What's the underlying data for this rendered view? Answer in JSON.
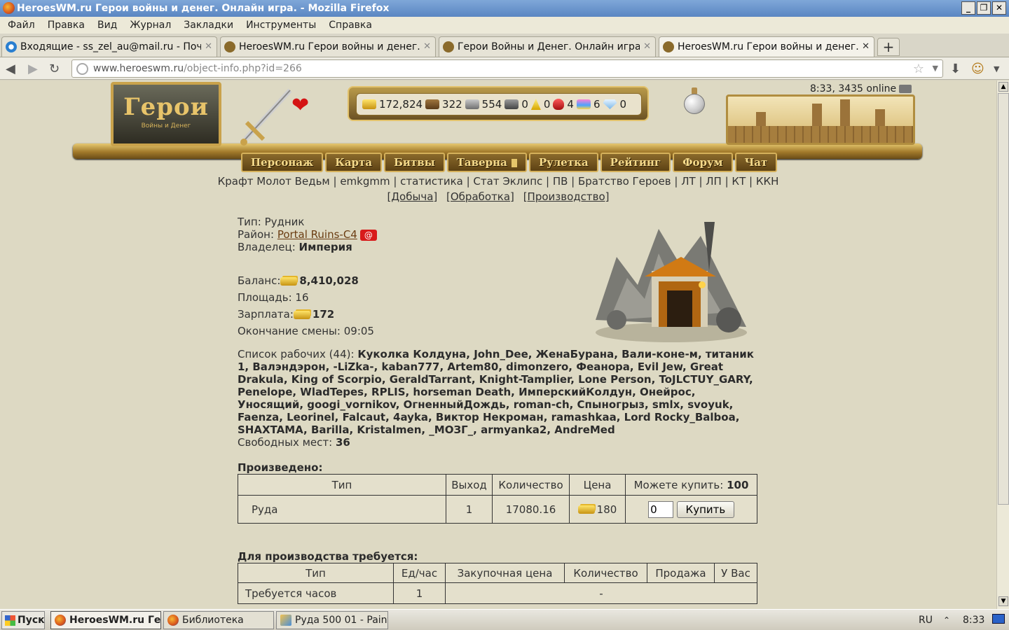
{
  "window": {
    "title": "HeroesWM.ru Герои войны и денег. Онлайн игра. - Mozilla Firefox",
    "buttons": [
      "_",
      "❐",
      "✕"
    ]
  },
  "menu": [
    "Файл",
    "Правка",
    "Вид",
    "Журнал",
    "Закладки",
    "Инструменты",
    "Справка"
  ],
  "tabs": [
    {
      "title": "Входящие - ss_zel_au@mail.ru - Почта ..."
    },
    {
      "title": "HeroesWM.ru Герои войны и денег. Он..."
    },
    {
      "title": "Герои Войны и Денег. Онлайн игра."
    },
    {
      "title": "HeroesWM.ru Герои войны и денег. Он..."
    }
  ],
  "url": {
    "host": "www.heroeswm.ru",
    "path": "/object-info.php?id=266"
  },
  "header": {
    "logo_big": "Герои",
    "logo_small": "Войны и Денег",
    "resources": {
      "gold": "172,824",
      "wood": "322",
      "ore": "554",
      "mercury": "0",
      "sulfur": "0",
      "crystal": "4",
      "gems": "6",
      "diamonds": "0"
    },
    "clock": "8:33, 3435 online"
  },
  "nav": [
    "Персонаж",
    "Карта",
    "Битвы",
    "Таверна",
    "Рулетка",
    "Рейтинг",
    "Форум",
    "Чат"
  ],
  "sublinks": "Крафт Молот Ведьм | emkgmm | статистика | Стат Эклипс | ПВ | Братство Героев | ЛТ | ЛП | КТ | ККН",
  "subsections": [
    "[Добыча]",
    "[Обработка]",
    "[Производство]"
  ],
  "object": {
    "type_label": "Тип:",
    "type_value": "Рудник",
    "district_label": "Район:",
    "district_value": "Portal Ruins-C4",
    "district_badge": "@",
    "owner_label": "Владелец:",
    "owner_value": "Империя",
    "balance_label": "Баланс:",
    "balance_value": "8,410,028",
    "area_label": "Площадь:",
    "area_value": "16",
    "salary_label": "Зарплата:",
    "salary_value": "172",
    "shift_label": "Окончание смены:",
    "shift_value": "09:05",
    "workers_label": "Список рабочих (44):",
    "workers": "Куколка Колдуна, John_Dee, ЖенаБурана, Вали-коне-м, титаник 1, Валэндэрон, -LiZka-, kaban777, Artem80, dimonzero, Феанора, Evil Jew, Great Drakula, King of Scorpio, GeraldTarrant, Knight-Tamplier, Lone Person, ToJLCTUY_GARY, Penelope, WladTepes, RPLIS, horseman Death, ИмперскийКолдун, Онейрос, Уносящий, googi_vornikov, ОгненныйДождь, roman-ch, Спыногрыз, smlx, svoyuk, Faenza, Leorinel, Falcaut, 4ayka, Виктор Некроман, ramashkaa, Lord Rocky_Balboa, SHAXTAMA, Barilla, Kristalmen, _МОЗГ_, armyanka2, AndreMed",
    "free_label": "Свободных мест:",
    "free_value": "36"
  },
  "produced": {
    "title": "Произведено:",
    "headers": [
      "Тип",
      "Выход",
      "Количество",
      "Цена",
      "Можете купить:"
    ],
    "can_buy": "100",
    "row": {
      "type": "Руда",
      "output": "1",
      "quantity": "17080.16",
      "price": "180",
      "input_value": "0",
      "buy_label": "Купить"
    }
  },
  "required": {
    "title": "Для производства требуется:",
    "headers": [
      "Тип",
      "Ед/час",
      "Закупочная цена",
      "Количество",
      "Продажа",
      "У Вас"
    ],
    "row": {
      "type": "Требуется часов",
      "per_hour": "1",
      "dash": "-"
    }
  },
  "taskbar": {
    "start": "Пуск",
    "tasks": [
      "HeroesWM.ru Ге...",
      "Библиотека",
      "Руда 500 01 - Paint"
    ],
    "lang": "RU",
    "time": "8:33"
  }
}
